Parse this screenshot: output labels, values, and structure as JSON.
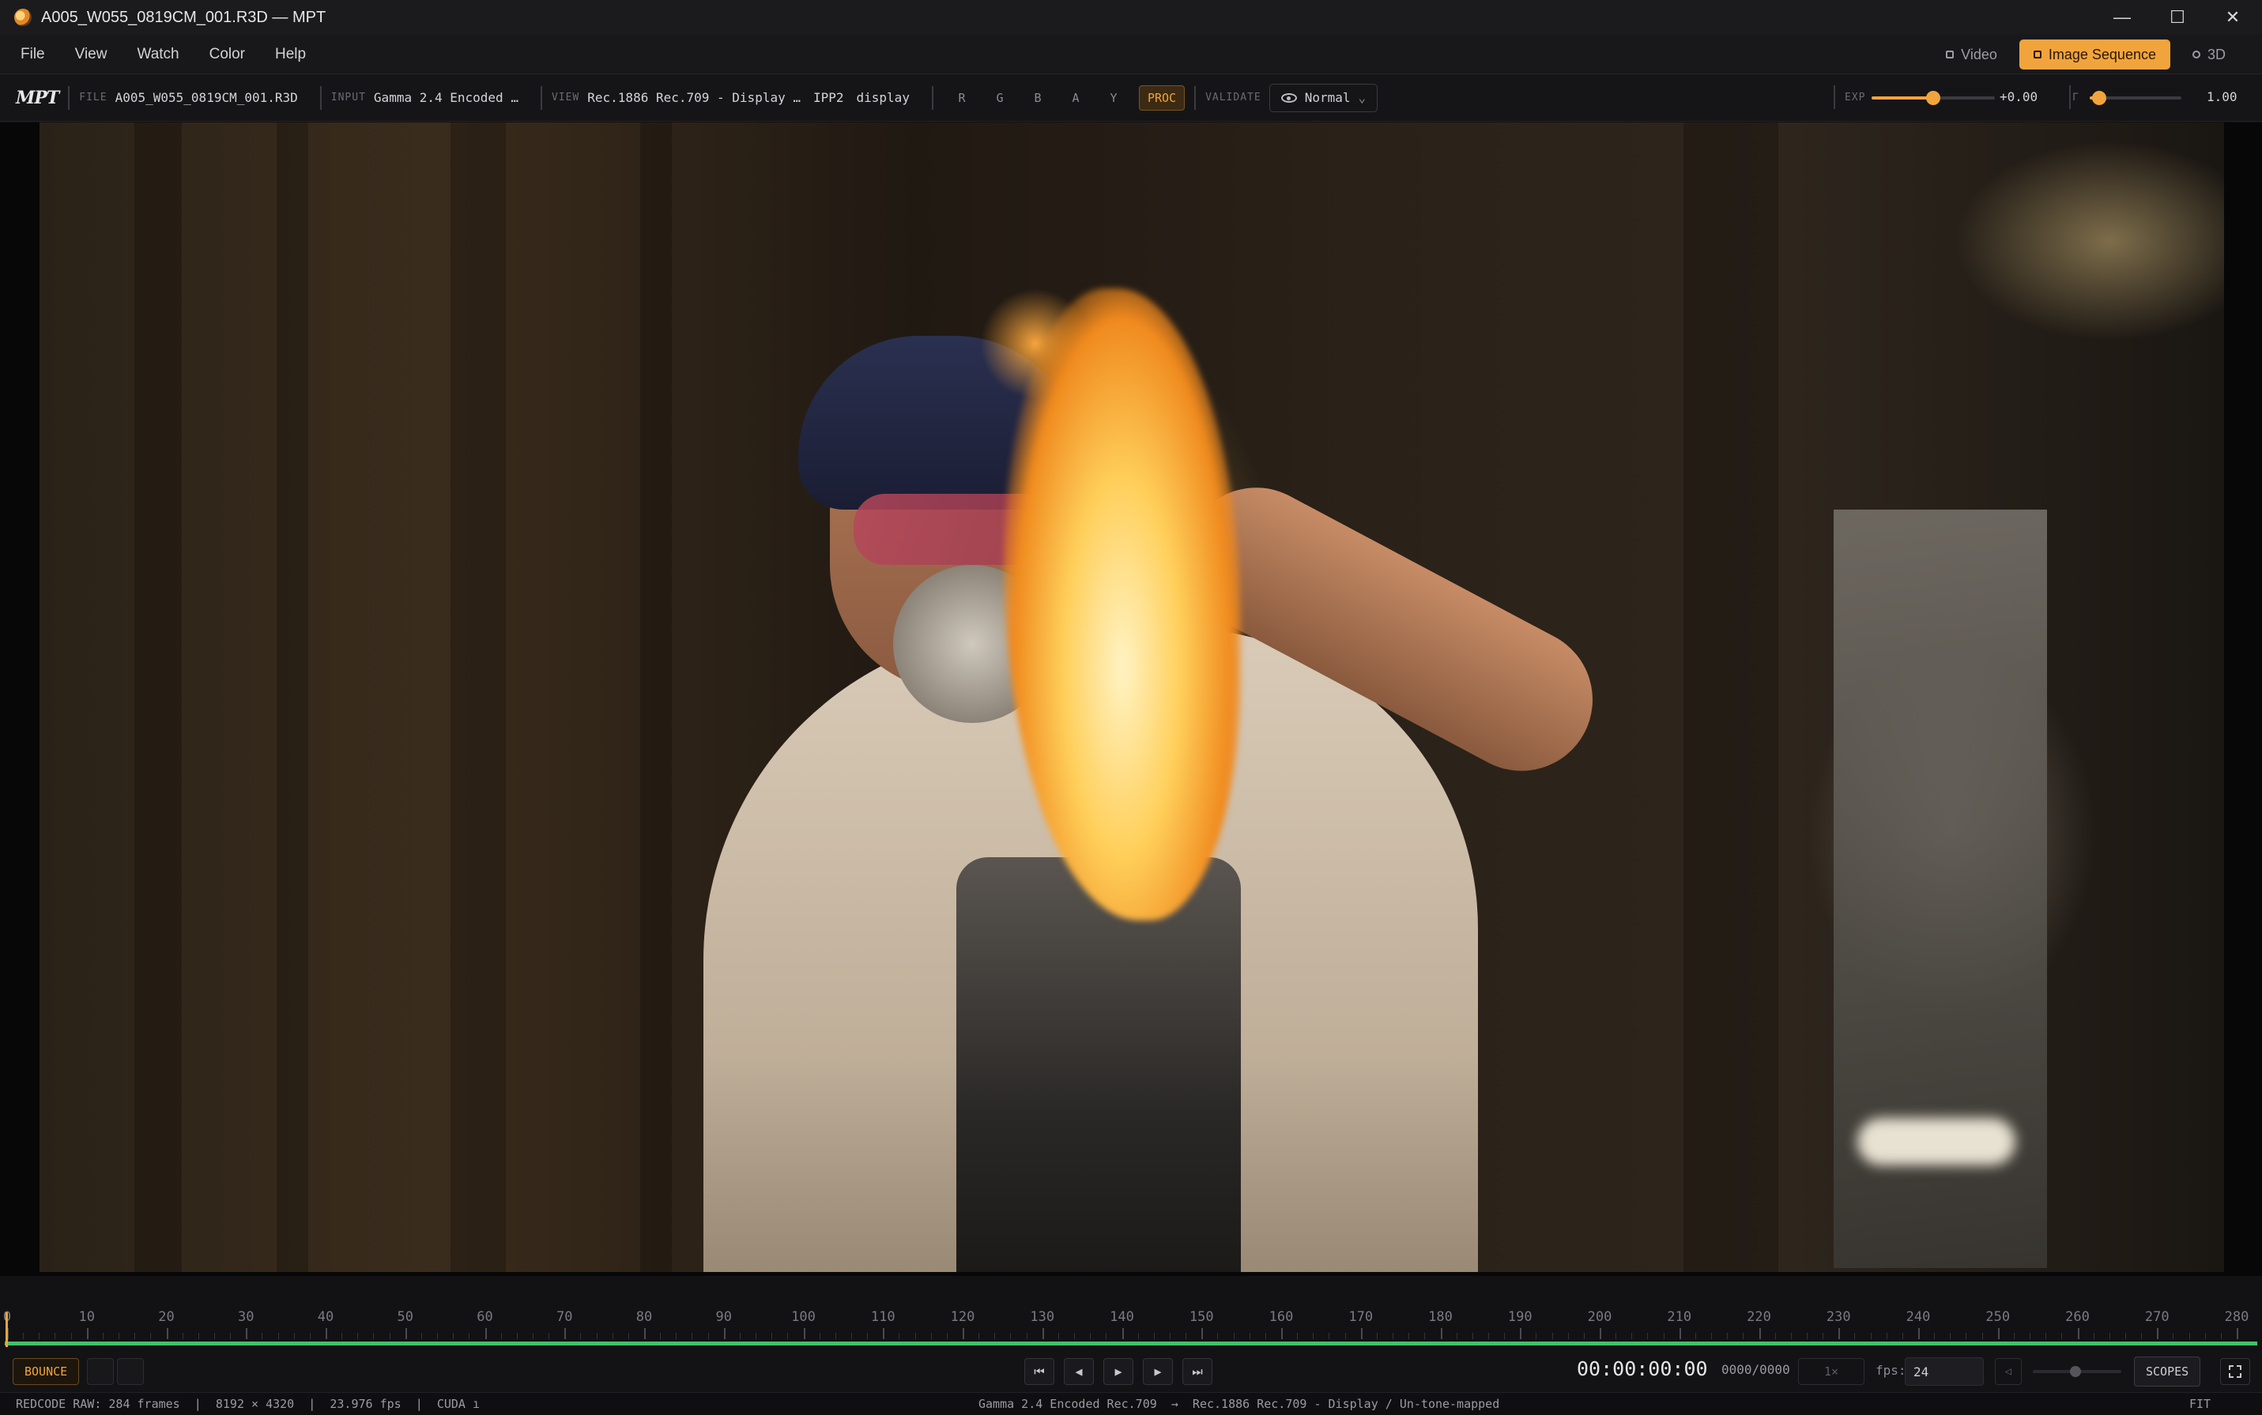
{
  "window": {
    "title": "A005_W055_0819CM_001.R3D — MPT",
    "minimize_symbol": "—",
    "maximize_symbol": "☐",
    "close_symbol": "✕"
  },
  "menu": {
    "items": [
      "File",
      "View",
      "Watch",
      "Color",
      "Help"
    ]
  },
  "modes": {
    "video_label": "Video",
    "image_sequence_label": "Image Sequence",
    "three_d_label": "3D",
    "active": "Image Sequence"
  },
  "toolbar": {
    "brand": "MPT",
    "file_label": "FILE",
    "file_value": "A005_W055_0819CM_001.R3D",
    "input_label": "INPUT",
    "input_value": "Gamma 2.4 Encoded …",
    "view_label": "VIEW",
    "view_value": "Rec.1886 Rec.709 - Display …",
    "view_look": "IPP2",
    "view_mode": "display",
    "channels": [
      "R",
      "G",
      "B",
      "A",
      "Y"
    ],
    "proc_label": "PROC",
    "validate_label": "VALIDATE",
    "validate_value": "Normal",
    "validate_caret": "⌄",
    "exposure_label": "EXP",
    "exposure_value": "+0.00",
    "exposure_level": 0.5,
    "gamma_label": "Γ",
    "gamma_value": "1.00",
    "gamma_level": 0.1
  },
  "timeline": {
    "ticks": [
      "0",
      "10",
      "20",
      "30",
      "40",
      "50",
      "60",
      "70",
      "80",
      "90",
      "100",
      "110",
      "120",
      "130",
      "140",
      "150",
      "160",
      "170",
      "180",
      "190",
      "200",
      "210",
      "220",
      "230",
      "240",
      "250",
      "260",
      "270",
      "280"
    ],
    "cached_fraction": 1.0,
    "playhead_frame": 0
  },
  "transport": {
    "bounce_label": "BOUNCE",
    "first_symbol": "⏮",
    "prev_symbol": "◀",
    "play_symbol": "▶",
    "next_symbol": "▶",
    "last_symbol": "⏭",
    "timecode": "00:00:00:00",
    "frame_counter": "0000/0000",
    "speed_placeholder": "1×",
    "fps_label": "fps:",
    "fps_value": "24",
    "volume_symbol": "◁",
    "volume_level": 0.5,
    "scopes_label": "SCOPES"
  },
  "status": {
    "left": "REDCODE RAW: 284 frames  |  8192 × 4320  |  23.976 fps  |  CUDA ı",
    "center": "Gamma 2.4 Encoded Rec.709  →  Rec.1886 Rec.709 - Display / Un-tone-mapped",
    "right": "FIT"
  },
  "colors": {
    "accent": "#f2a43c",
    "cache_bar": "#3ec46a",
    "background": "#111113"
  }
}
